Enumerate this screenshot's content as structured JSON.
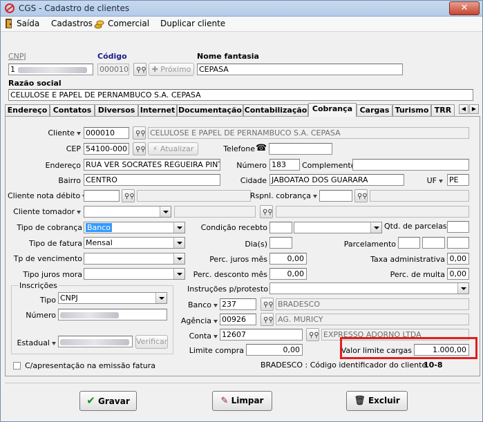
{
  "window": {
    "title": "CGS - Cadastro de clientes"
  },
  "menu": [
    "Saída",
    "Cadastros",
    "Comercial",
    "Duplicar cliente"
  ],
  "header": {
    "cnpj_label": "CNPJ",
    "cnpj_value": "1",
    "codigo_label": "Código",
    "codigo_value": "000010",
    "proximo_label": "Próximo",
    "nome_fantasia_label": "Nome fantasia",
    "nome_fantasia_value": "CEPASA",
    "razao_label": "Razão social",
    "razao_value": "CELULOSE E PAPEL DE PERNAMBUCO S.A. CEPASA"
  },
  "tabs": [
    "Endereço",
    "Contatos",
    "Diversos",
    "Internet",
    "Documentação",
    "Contabilização",
    "Cobrança",
    "Cargas",
    "Turismo",
    "TRR"
  ],
  "active_tab": "Cobrança",
  "form": {
    "cliente_label": "Cliente",
    "cliente_code": "000010",
    "cliente_name": "CELULOSE E PAPEL DE PERNAMBUCO S.A. CEPASA",
    "cep_label": "CEP",
    "cep_value": "54100-000",
    "atualizar_label": "Atualizar",
    "telefone_label": "Telefone",
    "telefone_value": "",
    "endereco_label": "Endereço",
    "endereco_value": "RUA VER SOCRATES REGUEIRA PINT",
    "numero_label": "Número",
    "numero_value": "183",
    "complemento_label": "Complemento",
    "complemento_value": "",
    "bairro_label": "Bairro",
    "bairro_value": "CENTRO",
    "cidade_label": "Cidade",
    "cidade_value": "JABOATAO DOS GUARARA",
    "uf_label": "UF",
    "uf_value": "PE",
    "cliente_nota_debito_label": "Cliente nota débito",
    "rspnl_cobranca_label": "Rspnl. cobrança",
    "cliente_tomador_label": "Cliente tomador",
    "tipo_cobranca_label": "Tipo de cobrança",
    "tipo_cobranca_value": "Banco",
    "condicao_recebto_label": "Condição recebto",
    "qtd_parcelas_label": "Qtd. de parcelas",
    "tipo_fatura_label": "Tipo de fatura",
    "tipo_fatura_value": "Mensal",
    "dias_label": "Dia(s)",
    "parcelamento_label": "Parcelamento",
    "tp_vencimento_label": "Tp de vencimento",
    "perc_juros_label": "Perc. juros mês",
    "perc_juros_value": "0,00",
    "taxa_adm_label": "Taxa administrativa",
    "taxa_adm_value": "0,00",
    "tipo_juros_label": "Tipo juros mora",
    "perc_desconto_label": "Perc. desconto mês",
    "perc_desconto_value": "0,00",
    "perc_multa_label": "Perc. de multa",
    "perc_multa_value": "0,00",
    "instrucoes_label": "Instruções p/protesto",
    "inscricoes_label": "Inscrições",
    "tipo_label": "Tipo",
    "tipo_value": "CNPJ",
    "numero_insc_label": "Número",
    "estadual_label": "Estadual",
    "verificar_label": "Verificar",
    "banco_label": "Banco",
    "banco_code": "237",
    "banco_name": "BRADESCO",
    "agencia_label": "Agência",
    "agencia_code": "00926",
    "agencia_name": "AG. MURICY",
    "conta_label": "Conta",
    "conta_code": "12607",
    "conta_name": "EXPRESSO ADORNO LTDA",
    "limite_compra_label": "Limite compra",
    "limite_compra_value": "0,00",
    "valor_limite_label": "Valor limite cargas",
    "valor_limite_value": "1.000,00",
    "capresentacao_label": "C/apresentação na emissão fatura",
    "bradesco_codigo_label": "BRADESCO : Código identificador do cliente",
    "bradesco_codigo_value": "10-8"
  },
  "buttons": {
    "gravar": "Gravar",
    "limpar": "Limpar",
    "excluir": "Excluir"
  },
  "colors": {
    "highlight": "#e21d1d",
    "selection": "#3399ff"
  }
}
